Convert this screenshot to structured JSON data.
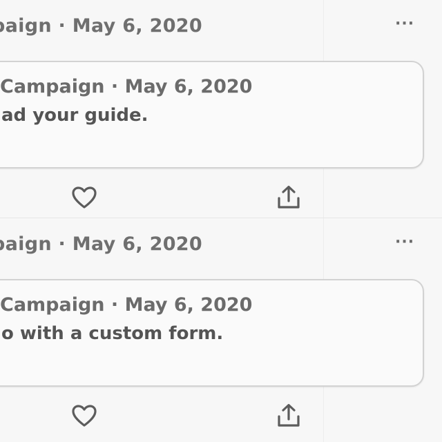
{
  "posts": [
    {
      "meta": "paign · May 6, 2020",
      "more_label": "···",
      "quote": {
        "meta": "Campaign · May 6, 2020",
        "text": "ad your guide."
      },
      "actions": {
        "like_icon": "heart-icon",
        "share_icon": "share-icon"
      }
    },
    {
      "meta": "paign · May 6, 2020",
      "more_label": "···",
      "quote": {
        "meta": "Campaign · May 6, 2020",
        "text": "o with a custom form."
      },
      "actions": {
        "like_icon": "heart-icon",
        "share_icon": "share-icon"
      }
    }
  ],
  "colors": {
    "background": "#f7f7f7",
    "text": "#5a5a5a",
    "border": "#d2d2d2"
  }
}
